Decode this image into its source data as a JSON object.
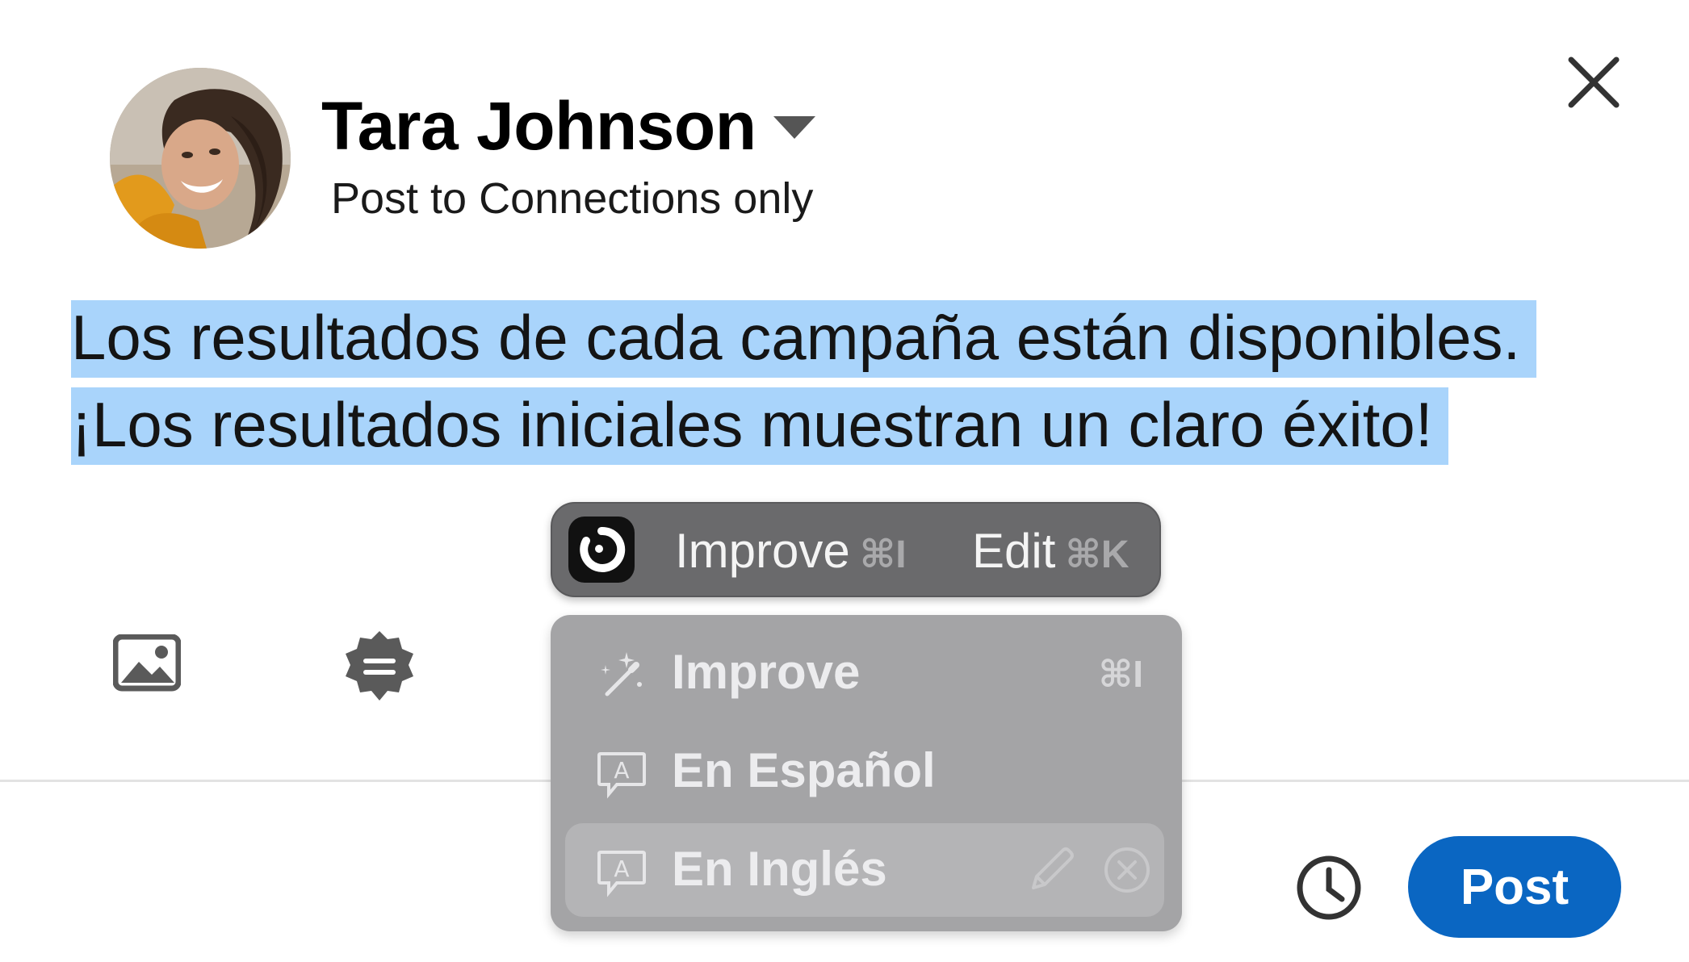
{
  "author": {
    "name": "Tara Johnson",
    "audience": "Post to Connections only",
    "avatar": "avatar-photo"
  },
  "post": {
    "text": "Los resultados de cada campaña están disponibles. ¡Los resultados iniciales muestran un claro éxito!",
    "selected": true
  },
  "toolbar": {
    "media_icon": "image-icon",
    "feature_icon": "badge-icon",
    "schedule_icon": "clock-icon",
    "post_label": "Post"
  },
  "ai_toolbar": {
    "logo": "ai-logo-icon",
    "improve_label": "Improve",
    "improve_shortcut": "⌘I",
    "edit_label": "Edit",
    "edit_shortcut": "⌘K"
  },
  "ai_menu": {
    "items": [
      {
        "label": "Improve",
        "icon": "magic-wand-icon",
        "shortcut": "⌘I"
      },
      {
        "label": "En Español",
        "icon": "translate-icon"
      },
      {
        "label": "En Inglés",
        "icon": "translate-icon",
        "edit_icon": "pencil-icon",
        "remove_icon": "remove-circle-icon"
      }
    ]
  },
  "colors": {
    "accent": "#0a66c2",
    "selection": "#a9d4fb",
    "pill": "#6a6a6c",
    "menu": "#a4a4a6"
  }
}
